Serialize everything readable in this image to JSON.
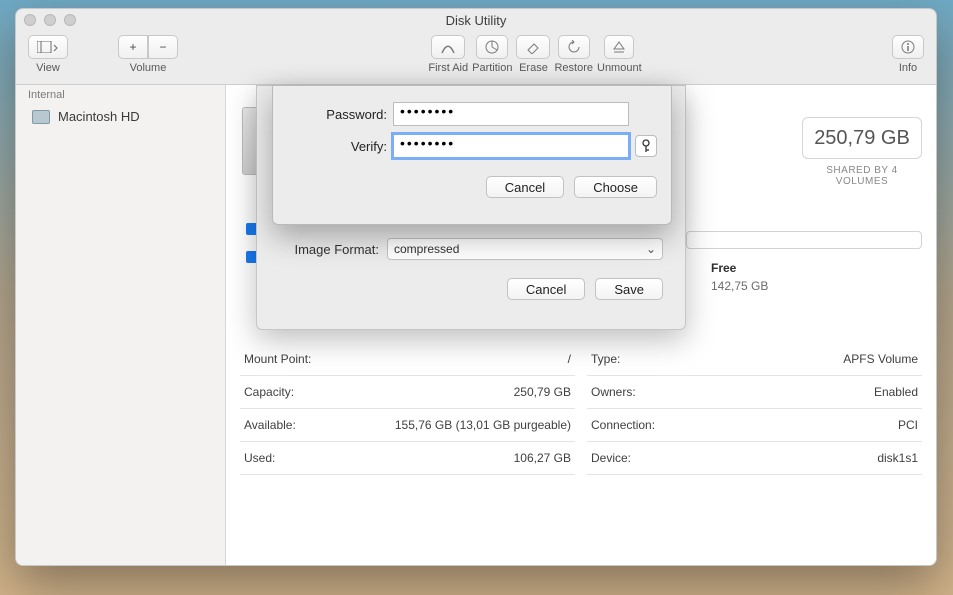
{
  "window": {
    "title": "Disk Utility"
  },
  "toolbar": {
    "view": "View",
    "volume": "Volume",
    "volume_add": "+",
    "volume_remove": "−",
    "first_aid": "First Aid",
    "partition": "Partition",
    "erase": "Erase",
    "restore": "Restore",
    "unmount": "Unmount",
    "info": "Info"
  },
  "sidebar": {
    "section": "Internal",
    "items": [
      {
        "label": "Macintosh HD"
      }
    ]
  },
  "disk": {
    "size": "250,79 GB",
    "shared": "SHARED BY 4 VOLUMES",
    "free_label": "Free",
    "free_value": "142,75 GB"
  },
  "info": {
    "left": [
      {
        "k": "Mount Point:",
        "v": "/"
      },
      {
        "k": "Capacity:",
        "v": "250,79 GB"
      },
      {
        "k": "Available:",
        "v": "155,76 GB (13,01 GB purgeable)"
      },
      {
        "k": "Used:",
        "v": "106,27 GB"
      }
    ],
    "right": [
      {
        "k": "Type:",
        "v": "APFS Volume"
      },
      {
        "k": "Owners:",
        "v": "Enabled"
      },
      {
        "k": "Connection:",
        "v": "PCI"
      },
      {
        "k": "Device:",
        "v": "disk1s1"
      }
    ]
  },
  "image_sheet": {
    "format_label": "Image Format:",
    "format_value": "compressed",
    "cancel": "Cancel",
    "save": "Save"
  },
  "password_sheet": {
    "pw_label": "Password:",
    "verify_label": "Verify:",
    "pw_value": "••••••••",
    "verify_value": "••••••••",
    "cancel": "Cancel",
    "choose": "Choose"
  }
}
